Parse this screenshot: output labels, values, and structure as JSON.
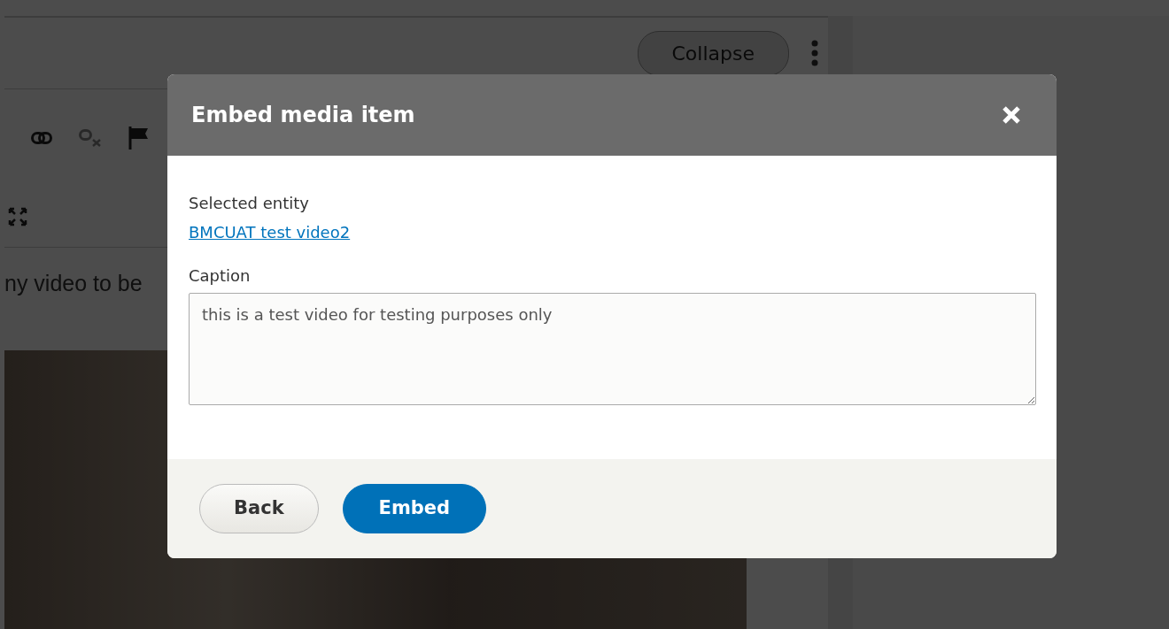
{
  "background_page": {
    "collapse_button": "Collapse",
    "editor_text": "ny video to be"
  },
  "dialog": {
    "title": "Embed media item",
    "fields": [
      {
        "kind": "link",
        "label": "Selected entity",
        "value": "BMCUAT test video2"
      },
      {
        "kind": "textarea",
        "label": "Caption",
        "value": "this is a test video for testing purposes only"
      }
    ],
    "buttons": [
      {
        "label": "Back",
        "primary": false
      },
      {
        "label": "Embed",
        "primary": true
      }
    ]
  }
}
